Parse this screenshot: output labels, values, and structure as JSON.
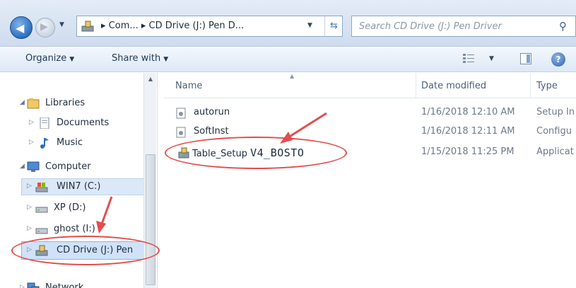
{
  "address_bar": {
    "path_text": "▸  Com...  ▸  CD Drive (J:) Pen D...",
    "search_placeholder": "Search CD Drive (J:) Pen Driver"
  },
  "toolbar": {
    "organize_label": "Organize",
    "share_label": "Share with"
  },
  "nav_tree": {
    "libraries": "Libraries",
    "documents": "Documents",
    "music": "Music",
    "computer": "Computer",
    "win7": "WIN7 (C:)",
    "xp": "XP (D:)",
    "ghost": "ghost (I:)",
    "cd_drive": "CD Drive (J:) Pen",
    "network": "Network"
  },
  "columns": {
    "name": "Name",
    "date_modified": "Date modified",
    "type": "Type"
  },
  "files": [
    {
      "name": "autorun",
      "date": "1/16/2018 12:10 AM",
      "type": "Setup In"
    },
    {
      "name": "SoftInst",
      "date": "1/16/2018 12:11 AM",
      "type": "Configu"
    },
    {
      "name_prefix": "Table_Setup",
      "name_suffix": "V4_BOSTO",
      "date": "1/15/2018 11:25 PM",
      "type": "Applicat"
    }
  ],
  "colors": {
    "annotation_red": "#e44d4d",
    "selection_blue": "#cfe2f8"
  }
}
